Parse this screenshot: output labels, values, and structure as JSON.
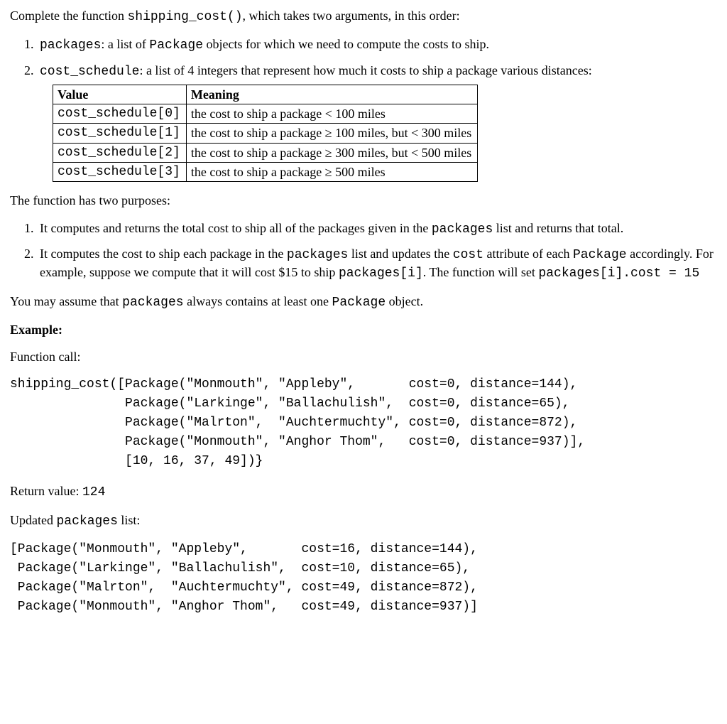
{
  "intro": {
    "pre": "Complete the function ",
    "fn": "shipping_cost()",
    "post": ", which takes two arguments, in this order:"
  },
  "args": [
    {
      "name": "packages",
      "desc_pre": ": a list of ",
      "obj": "Package",
      "desc_post": " objects for which we need to compute the costs to ship."
    },
    {
      "name": "cost_schedule",
      "desc_pre": ": a list of 4 integers that represent how much it costs to ship a package various distances:",
      "obj": "",
      "desc_post": ""
    }
  ],
  "table": {
    "h1": "Value",
    "h2": "Meaning",
    "rows": [
      {
        "v": "cost_schedule[0]",
        "m": "the cost to ship a package < 100 miles"
      },
      {
        "v": "cost_schedule[1]",
        "m": "the cost to ship a package ≥ 100 miles, but < 300 miles"
      },
      {
        "v": "cost_schedule[2]",
        "m": "the cost to ship a package ≥ 300 miles, but < 500 miles"
      },
      {
        "v": "cost_schedule[3]",
        "m": "the cost to ship a package ≥ 500 miles"
      }
    ]
  },
  "purposes_intro": "The function has two purposes:",
  "purposes": [
    {
      "t1": "It computes and returns the total cost to ship all of the packages given in the ",
      "m1": "packages",
      "t2": " list and returns that total."
    },
    {
      "t1": "It computes the cost to ship each package in the ",
      "m1": "packages",
      "t2": " list and updates the ",
      "m2": "cost",
      "t3": " attribute of each ",
      "m3": "Package",
      "t4": " accordingly. For example, suppose we compute that it will cost $15 to ship ",
      "m4": "packages[i]",
      "t5": ". The function will set ",
      "m5": "packages[i].cost = 15"
    }
  ],
  "assume": {
    "t1": "You may assume that ",
    "m1": "packages",
    "t2": " always contains at least one ",
    "m2": "Package",
    "t3": " object."
  },
  "example_label": "Example:",
  "fcall_label": "Function call:",
  "call_code": "shipping_cost([Package(\"Monmouth\", \"Appleby\",       cost=0, distance=144),\n               Package(\"Larkinge\", \"Ballachulish\",  cost=0, distance=65),\n               Package(\"Malrton\",  \"Auchtermuchty\", cost=0, distance=872),\n               Package(\"Monmouth\", \"Anghor Thom\",   cost=0, distance=937)],\n               [10, 16, 37, 49])}",
  "retval": {
    "label": "Return value: ",
    "val": "124"
  },
  "updated": {
    "t1": "Updated ",
    "m1": "packages",
    "t2": " list:"
  },
  "updated_code": "[Package(\"Monmouth\", \"Appleby\",       cost=16, distance=144),\n Package(\"Larkinge\", \"Ballachulish\",  cost=10, distance=65),\n Package(\"Malrton\",  \"Auchtermuchty\", cost=49, distance=872),\n Package(\"Monmouth\", \"Anghor Thom\",   cost=49, distance=937)]"
}
